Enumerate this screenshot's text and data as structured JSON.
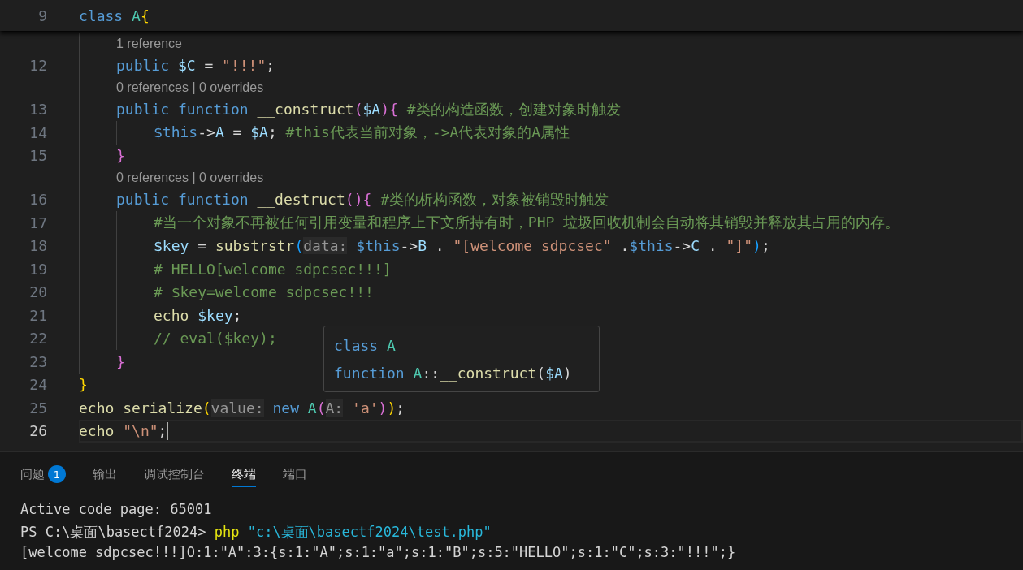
{
  "editor": {
    "sticky_line": {
      "number": "9",
      "text": "class A{"
    },
    "lines": [
      {
        "kind": "lens",
        "text": "1 reference"
      },
      {
        "kind": "code",
        "number": "12",
        "current": false,
        "text": "    public $C = \"!!!\";"
      },
      {
        "kind": "lens",
        "text": "0 references | 0 overrides"
      },
      {
        "kind": "code",
        "number": "13",
        "current": false,
        "text": "    public function __construct($A){ #类的构造函数，创建对象时触发"
      },
      {
        "kind": "code",
        "number": "14",
        "current": false,
        "text": "        $this->A = $A; #this代表当前对象，->A代表对象的A属性"
      },
      {
        "kind": "code",
        "number": "15",
        "current": false,
        "text": "    }"
      },
      {
        "kind": "lens",
        "text": "0 references | 0 overrides"
      },
      {
        "kind": "code",
        "number": "16",
        "current": false,
        "text": "    public function __destruct(){ #类的析构函数，对象被销毁时触发"
      },
      {
        "kind": "code",
        "number": "17",
        "current": false,
        "text": "        #当一个对象不再被任何引用变量和程序上下文所持有时，PHP 垃圾回收机制会自动将其销毁并释放其占用的内存。"
      },
      {
        "kind": "code",
        "number": "18",
        "current": false,
        "text": "        $key = substrstr(data: $this->B . \"[welcome sdpcsec\" .$this->C . \"]\");"
      },
      {
        "kind": "code",
        "number": "19",
        "current": false,
        "text": "        # HELLO[welcome sdpcsec!!!]"
      },
      {
        "kind": "code",
        "number": "20",
        "current": false,
        "text": "        # $key=welcome sdpcsec!!!"
      },
      {
        "kind": "code",
        "number": "21",
        "current": false,
        "text": "        echo $key;"
      },
      {
        "kind": "code",
        "number": "22",
        "current": false,
        "text": "        // eval($key);"
      },
      {
        "kind": "code",
        "number": "23",
        "current": false,
        "text": "    }"
      },
      {
        "kind": "code",
        "number": "24",
        "current": false,
        "text": "}"
      },
      {
        "kind": "code",
        "number": "25",
        "current": false,
        "text": "echo serialize(value: new A(A: 'a'));"
      },
      {
        "kind": "code",
        "number": "26",
        "current": true,
        "text": "echo \"\\n\";"
      }
    ],
    "hover": {
      "lines": [
        "class A",
        "function A::__construct($A)"
      ]
    }
  },
  "panel": {
    "tabs": [
      {
        "label": "问题",
        "badge": "1",
        "selected": false
      },
      {
        "label": "输出",
        "selected": false
      },
      {
        "label": "调试控制台",
        "selected": false
      },
      {
        "label": "终端",
        "selected": true
      },
      {
        "label": "端口",
        "selected": false
      }
    ],
    "terminal": [
      "Active code page: 65001",
      "PS C:\\桌面\\basectf2024> php \"c:\\桌面\\basectf2024\\test.php\"",
      "[welcome sdpcsec!!!]O:1:\"A\":3:{s:1:\"A\";s:1:\"a\";s:1:\"B\";s:5:\"HELLO\";s:1:\"C\";s:3:\"!!!\";}"
    ]
  }
}
